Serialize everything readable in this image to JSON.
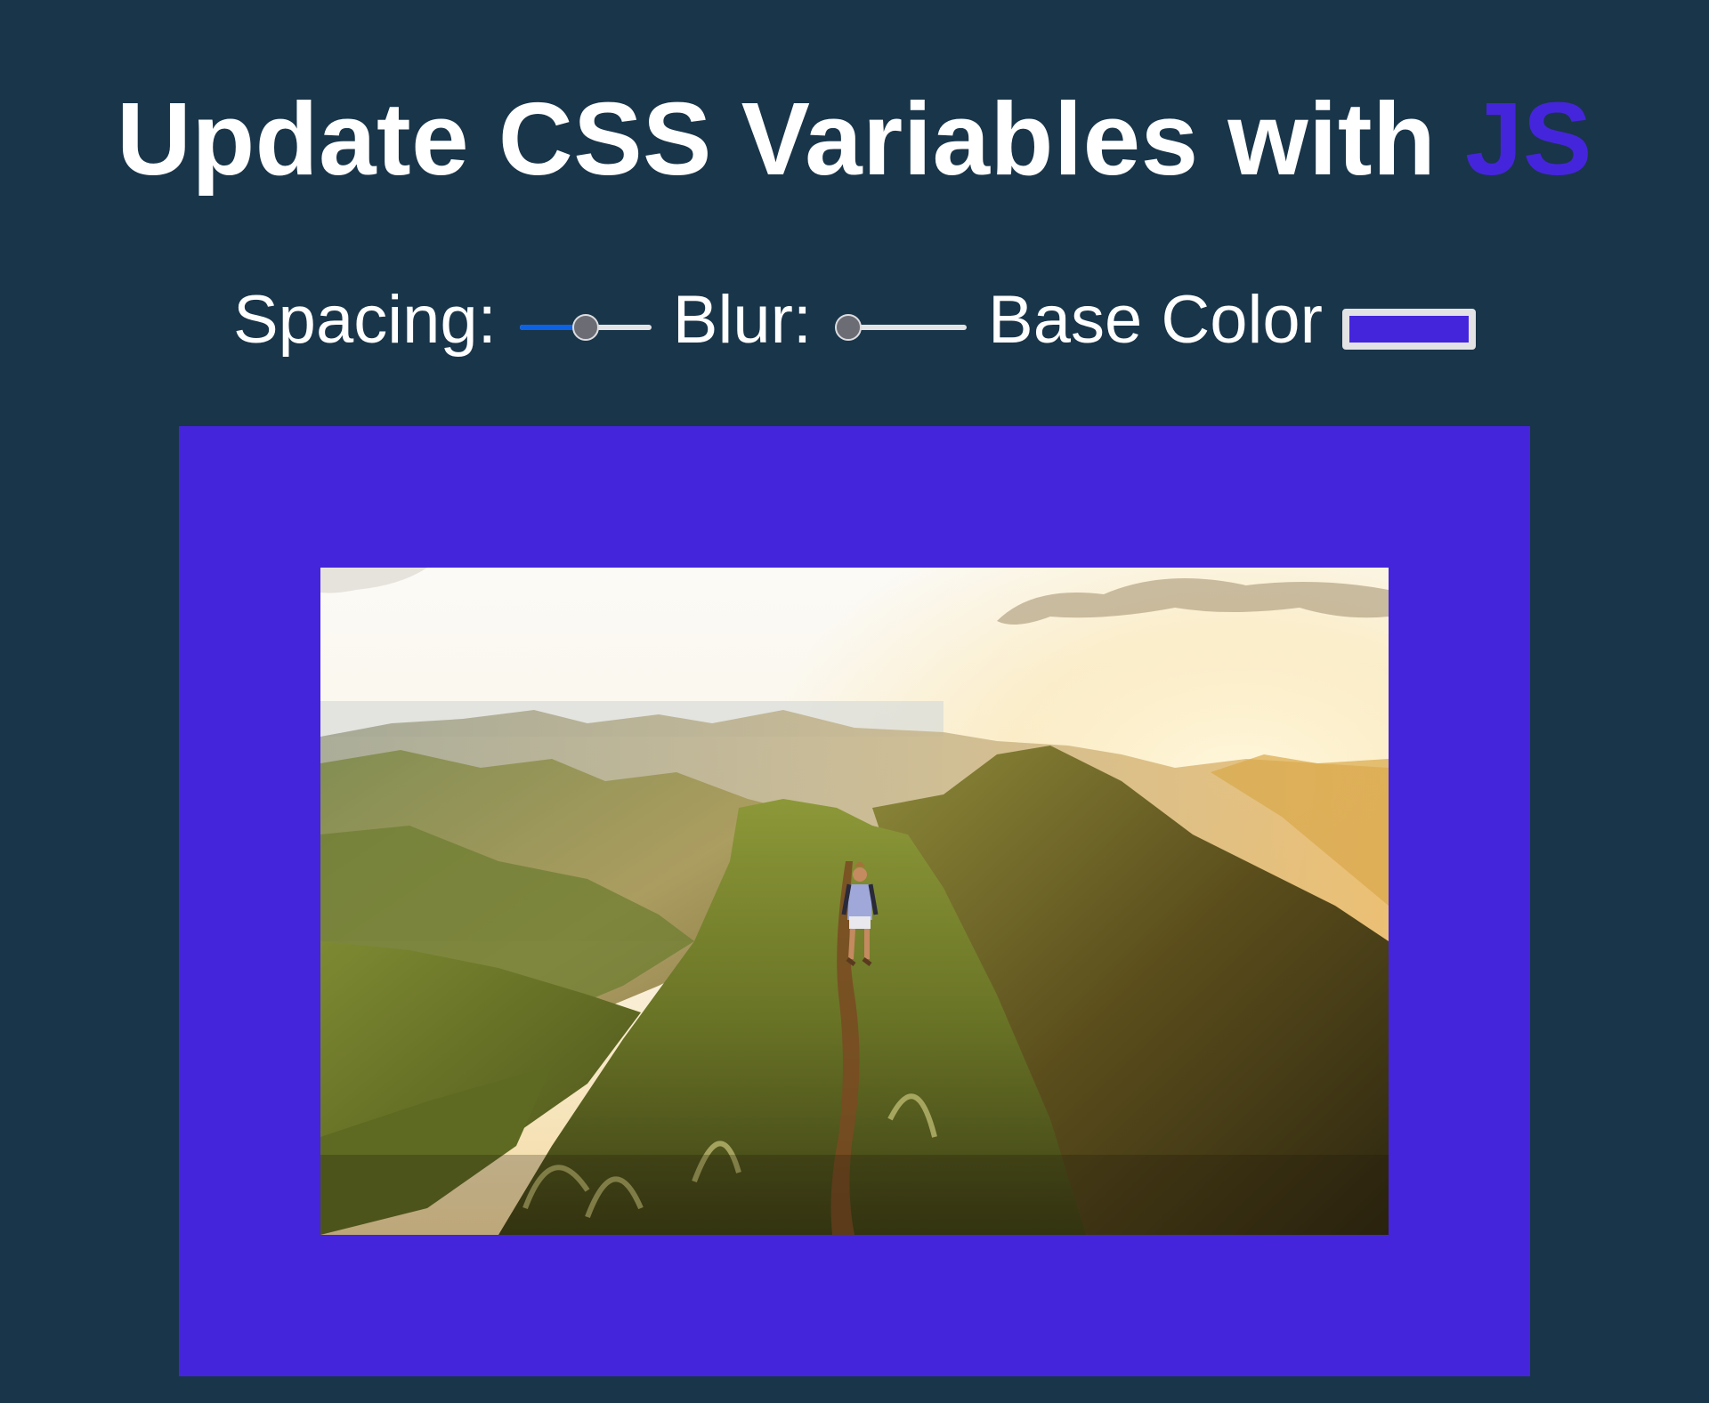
{
  "title": {
    "prefix": "Update CSS Variables with ",
    "highlight": "JS",
    "highlight_color": "#4525db"
  },
  "controls": {
    "spacing": {
      "label": "Spacing:",
      "value_fraction": 0.5
    },
    "blur": {
      "label": "Blur:",
      "value_fraction": 0.0
    },
    "base_color": {
      "label": "Base Color",
      "value": "#4525db"
    }
  },
  "colors": {
    "background": "#193549",
    "base": "#4525db",
    "slider_fill": "#0b62e4",
    "text": "#ffffff"
  },
  "image": {
    "subject": "hiker walking along a grassy mountain ridge at sunrise"
  }
}
